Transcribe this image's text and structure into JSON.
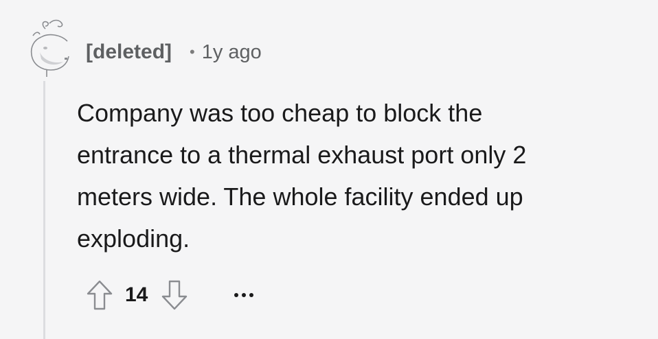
{
  "comment": {
    "author": "[deleted]",
    "separator": "•",
    "timestamp": "1y ago",
    "body_lines": [
      "Company was too cheap to block the",
      "entrance to a thermal exhaust port only 2",
      "meters wide. The whole facility ended up",
      "exploding."
    ],
    "score": "14",
    "icons": {
      "avatar": "deleted-user-avatar-icon",
      "upvote": "upvote-arrow-icon",
      "downvote": "downvote-arrow-icon",
      "more": "more-options-icon"
    },
    "colors": {
      "background": "#f5f5f6",
      "text": "#1a1a1b",
      "meta": "#5e6062",
      "thread_line": "#dcdde0",
      "icon_stroke": "#8a8c90"
    }
  }
}
